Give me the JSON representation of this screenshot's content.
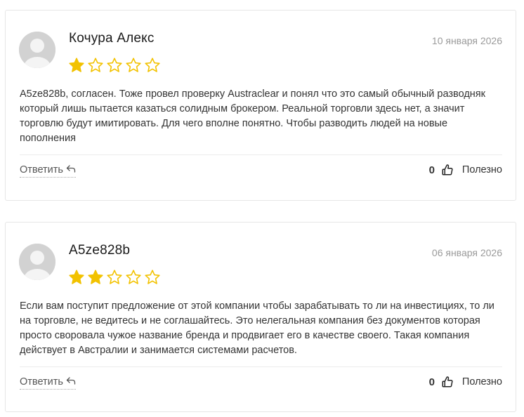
{
  "reviews": [
    {
      "author": "Кочура Алекс",
      "date": "10 января 2026",
      "rating": 1,
      "max_rating": 5,
      "text": "A5ze828b, согласен. Тоже провел проверку Austraclear и понял что это самый обычный разводняк который лишь пытается казаться солидным брокером. Реальной торговли здесь нет, а значит торговлю будут имитировать. Для чего вполне понятно. Чтобы разводить людей на новые пополнения",
      "reply_label": "Ответить",
      "helpful_count": "0",
      "helpful_label": "Полезно"
    },
    {
      "author": "A5ze828b",
      "date": "06 января 2026",
      "rating": 2,
      "max_rating": 5,
      "text": "Если вам поступит предложение от этой компании чтобы зарабатывать то ли на инвестициях, то ли на торговле, не ведитесь и не соглашайтесь. Это нелегальная компания без документов которая просто своровала чужое название бренда и продвигает его в качестве своего. Такая компания действует в Австралии и занимается системами расчетов.",
      "reply_label": "Ответить",
      "helpful_count": "0",
      "helpful_label": "Полезно"
    }
  ],
  "colors": {
    "star_filled": "#f2c200",
    "star_empty_stroke": "#f2c200",
    "avatar_bg": "#d2d2d2",
    "avatar_figure": "#f4f4f4"
  },
  "icons": {
    "reply": "reply-arrow-icon",
    "thumb": "thumbs-up-icon",
    "star": "star-icon",
    "avatar": "user-avatar-icon"
  }
}
